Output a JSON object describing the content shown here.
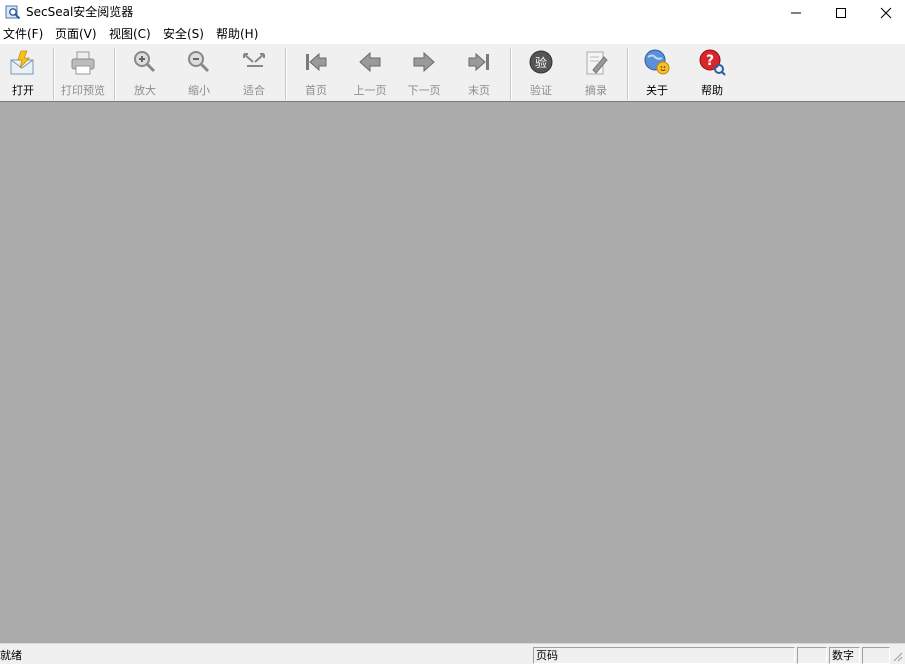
{
  "window": {
    "title": "SecSeal安全阅览器"
  },
  "menu": [
    {
      "label": "文件(F)"
    },
    {
      "label": "页面(V)"
    },
    {
      "label": "视图(C)"
    },
    {
      "label": "安全(S)"
    },
    {
      "label": "帮助(H)"
    }
  ],
  "toolbar": {
    "open": "打开",
    "print_preview": "打印预览",
    "zoom_in": "放大",
    "zoom_out": "缩小",
    "fit": "适合",
    "first_page": "首页",
    "prev_page": "上一页",
    "next_page": "下一页",
    "last_page": "末页",
    "verify": "验证",
    "excerpt": "摘录",
    "about": "关于",
    "help": "帮助",
    "verify_icon_char": "验"
  },
  "status": {
    "ready": "就绪",
    "page_label": "页码",
    "num_label": "数字"
  },
  "colors": {
    "workspace": "#ababab",
    "toolbar": "#f0f0f0",
    "disabled_text": "#8d8d8d"
  }
}
